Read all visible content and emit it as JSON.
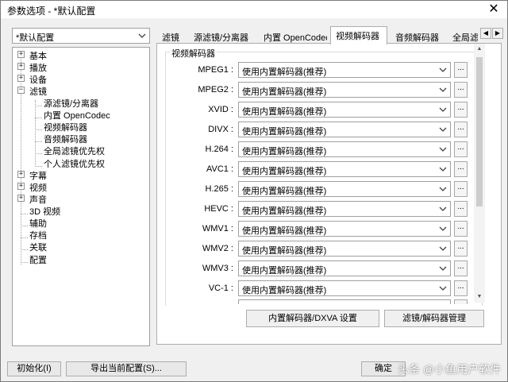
{
  "window": {
    "title": "参数选项 - *默认配置",
    "close_glyph": "✕"
  },
  "profile": {
    "value": "*默认配置",
    "dropdown_icon": "chevron-down-icon"
  },
  "tree": {
    "items": [
      {
        "label": "基本",
        "expander": "+"
      },
      {
        "label": "播放",
        "expander": "+"
      },
      {
        "label": "设备",
        "expander": "+"
      },
      {
        "label": "滤镜",
        "expander": "−"
      },
      {
        "label": "源滤镜/分离器"
      },
      {
        "label": "内置 OpenCodec"
      },
      {
        "label": "视频解码器"
      },
      {
        "label": "音频解码器"
      },
      {
        "label": "全局滤镜优先权"
      },
      {
        "label": "个人滤镜优先权"
      },
      {
        "label": "字幕",
        "expander": "+"
      },
      {
        "label": "视频",
        "expander": "+"
      },
      {
        "label": "声音",
        "expander": "+"
      },
      {
        "label": "3D 视频"
      },
      {
        "label": "辅助"
      },
      {
        "label": "存档"
      },
      {
        "label": "关联"
      },
      {
        "label": "配置"
      }
    ]
  },
  "tabs": [
    {
      "label": "滤镜"
    },
    {
      "label": "源滤镜/分离器"
    },
    {
      "label": "内置 OpenCodec"
    },
    {
      "label": "视频解码器",
      "active": true
    },
    {
      "label": "音频解码器"
    },
    {
      "label": "全局滤"
    }
  ],
  "tab_scroll": {
    "left": "◀",
    "right": "▶"
  },
  "decoders": {
    "group_title": "视频解码器",
    "rows": [
      {
        "label": "MPEG1 :",
        "value": "使用内置解码器(推荐)"
      },
      {
        "label": "MPEG2 :",
        "value": "使用内置解码器(推荐)"
      },
      {
        "label": "XVID :",
        "value": "使用内置解码器(推荐)"
      },
      {
        "label": "DIVX :",
        "value": "使用内置解码器(推荐)"
      },
      {
        "label": "H.264 :",
        "value": "使用内置解码器(推荐)"
      },
      {
        "label": "AVC1 :",
        "value": "使用内置解码器(推荐)"
      },
      {
        "label": "H.265 :",
        "value": "使用内置解码器(推荐)"
      },
      {
        "label": "HEVC :",
        "value": "使用内置解码器(推荐)"
      },
      {
        "label": "WMV1 :",
        "value": "使用内置解码器(推荐)"
      },
      {
        "label": "WMV2 :",
        "value": "使用内置解码器(推荐)"
      },
      {
        "label": "WMV3 :",
        "value": "使用内置解码器(推荐)"
      },
      {
        "label": "VC-1 :",
        "value": "使用内置解码器(推荐)"
      }
    ],
    "more_button_label": "...",
    "scroll": {
      "up": "▲",
      "down": "▼"
    }
  },
  "panel_buttons": {
    "dxva": "内置解码器/DXVA 设置",
    "manage": "滤镜/解码器管理"
  },
  "footer": {
    "init": "初始化(I)",
    "export": "导出当前配置(S)...",
    "ok": "确定",
    "watermark": "头条 @小鱼用户软件"
  }
}
